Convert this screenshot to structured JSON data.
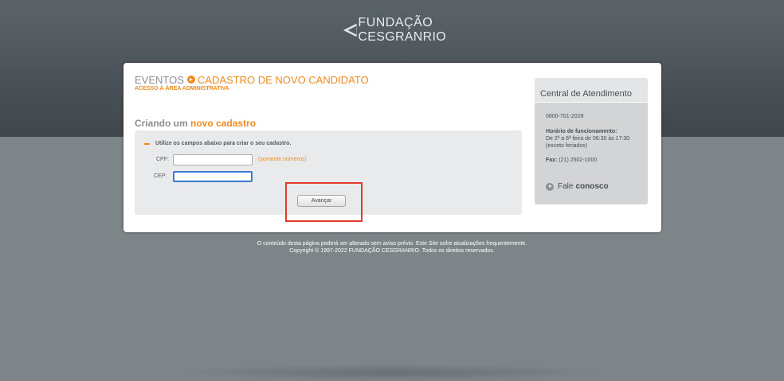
{
  "logo": {
    "line1": "FUNDAÇÃO",
    "line2": "CESGRANRIO"
  },
  "header": {
    "eventos": "EVENTOS",
    "title": "CADASTRO DE NOVO CANDIDATO",
    "subtitle": "ACESSO À ÁREA ADMINISTRATIVA"
  },
  "section": {
    "prefix": "Criando um",
    "highlight": "novo cadastro"
  },
  "form": {
    "instruction": "Utilize os campos abaixo para criar o seu cadastro.",
    "cpf_label": "CPF:",
    "cpf_value": "",
    "cpf_hint": "(somente números)",
    "cep_label": "CEP:",
    "cep_value": "",
    "submit_label": "Avançar"
  },
  "side": {
    "title": "Central de Atendimento",
    "phone": "0800-701-2028",
    "hours_title": "Horário de funcionamento:",
    "hours_value": "De 2ª a 6ª feira de 08:30 às 17:30",
    "hours_note": "(exceto feriados)",
    "fax_label": "Fax:",
    "fax_value": "(21) 2502-1000",
    "contact_prefix": "Fale",
    "contact_bold": "conosco"
  },
  "footer": {
    "line1": "O conteúdo desta página poderá ser alterado sem aviso prévio.   Este Site sofre atualizações frequentemente.",
    "line2": "Copyright © 1997-2022 FUNDAÇÃO CESGRANRIO.   Todos os direitos reservados."
  },
  "colors": {
    "accent": "#f08a1c",
    "highlight": "#e03a2a",
    "focus": "#3a7bd5"
  }
}
